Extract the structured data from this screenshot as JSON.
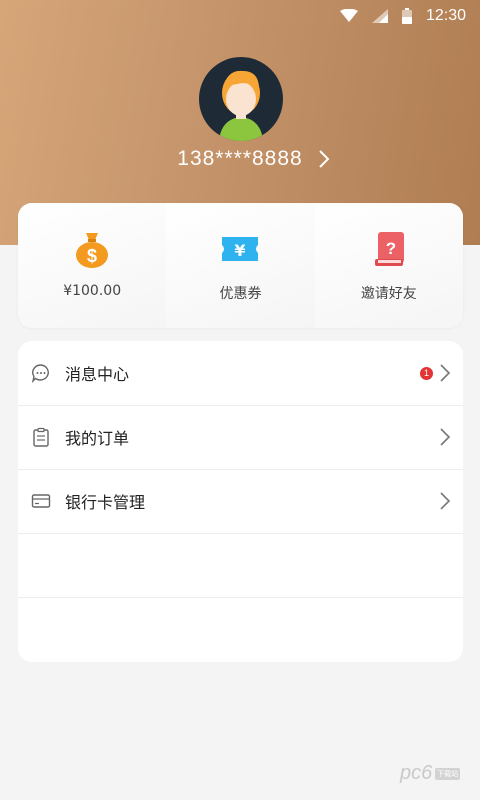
{
  "status_bar": {
    "time": "12:30",
    "icons": [
      "wifi-icon",
      "signal-icon",
      "battery-icon"
    ]
  },
  "profile": {
    "phone": "138****8888",
    "avatar_icon": "avatar-icon"
  },
  "wallet": {
    "items": [
      {
        "label": "¥100.00",
        "icon": "money-bag-icon",
        "color": "#f39a1f"
      },
      {
        "label": "优惠券",
        "icon": "coupon-icon",
        "color": "#2fb2f0"
      },
      {
        "label": "邀请好友",
        "icon": "invite-book-icon",
        "color": "#ec6165"
      }
    ]
  },
  "menu": {
    "items": [
      {
        "label": "消息中心",
        "icon": "message-icon",
        "badge": "1"
      },
      {
        "label": "我的订单",
        "icon": "order-icon"
      },
      {
        "label": "银行卡管理",
        "icon": "bank-card-icon"
      }
    ]
  },
  "watermark": {
    "text": "pc6",
    "badge": "下载站"
  },
  "colors": {
    "header_start": "#d6a679",
    "header_end": "#b07d52",
    "badge_red": "#e23434"
  }
}
